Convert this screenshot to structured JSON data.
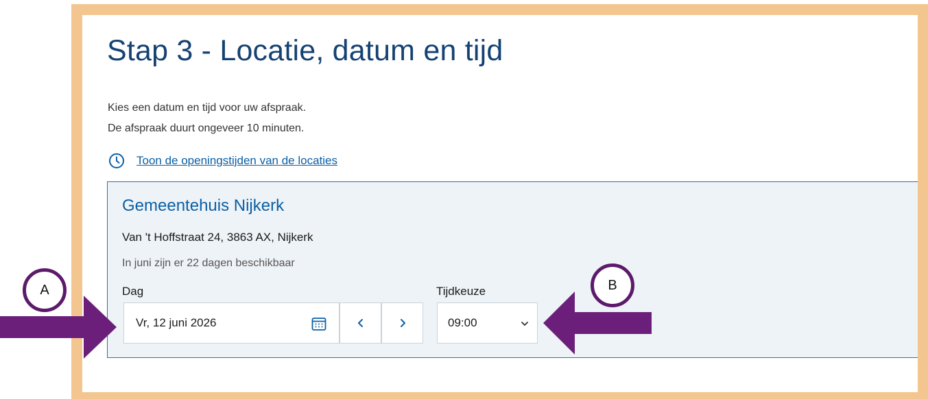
{
  "page": {
    "title": "Stap 3 - Locatie, datum en tijd",
    "intro_line1": "Kies een datum en tijd voor uw afspraak.",
    "intro_line2": "De afspraak duurt ongeveer 10 minuten.",
    "opening_hours_link": "Toon de openingstijden van de locaties",
    "icons": {
      "hours": "clock-icon",
      "date": "calendar-icon",
      "prev": "chevron-left-icon",
      "next": "chevron-right-icon",
      "select": "chevron-down-icon"
    }
  },
  "location": {
    "name": "Gemeentehuis Nijkerk",
    "address": "Van 't Hoffstraat 24, 3863 AX, Nijkerk",
    "availability": "In juni zijn er 22 dagen beschikbaar"
  },
  "date_field": {
    "label": "Dag",
    "value": "Vr, 12 juni 2026"
  },
  "time_field": {
    "label": "Tijdkeuze",
    "value": "09:00"
  },
  "annotations": {
    "marker_a": "A",
    "marker_b": "B"
  },
  "colors": {
    "frame": "#f3c690",
    "heading": "#154273",
    "link": "#0b5fa5",
    "card_background": "#eef3f7",
    "annotation": "#6b1f7a"
  }
}
